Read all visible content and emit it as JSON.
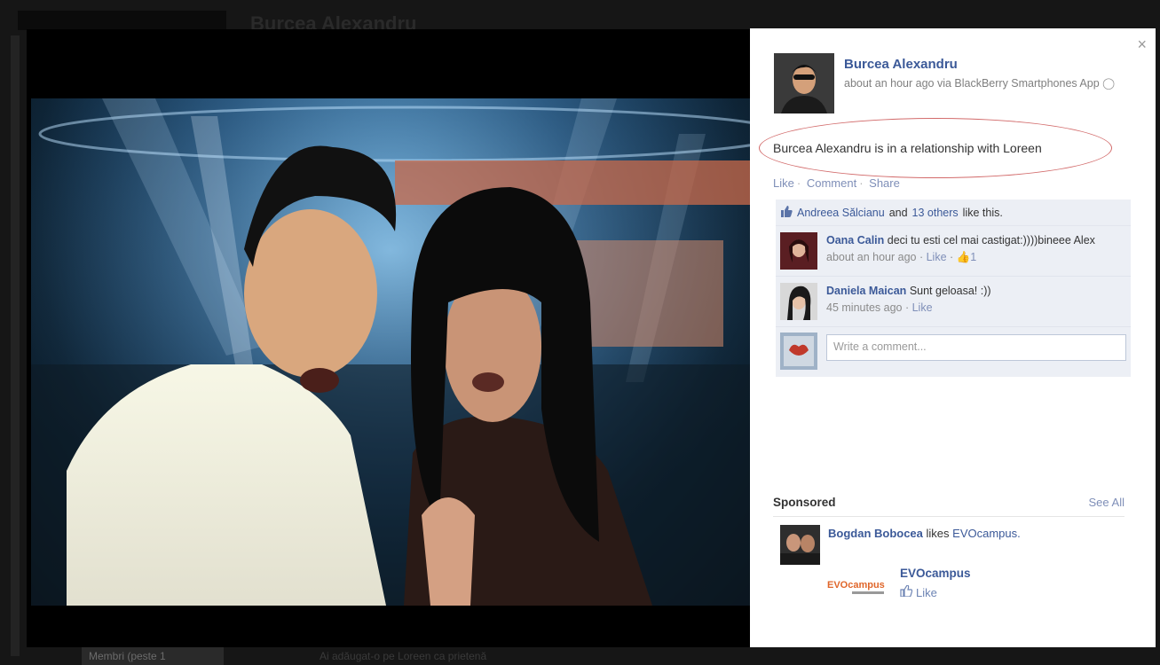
{
  "background": {
    "title": "Burcea Alexandru",
    "bottom_label": "Membri (peste 1",
    "bottom_text": "Ai adăugat-o pe Loreen ca prietenă"
  },
  "post": {
    "author_name": "Burcea Alexandru",
    "meta": "about an hour ago via BlackBerry Smartphones App",
    "status": "Burcea Alexandru is in a relationship with Loreen",
    "actions": {
      "like": "Like",
      "comment": "Comment",
      "share": "Share"
    },
    "close_label": "×"
  },
  "ufi": {
    "likes": {
      "name": "Andreea Sălcianu",
      "and": "and",
      "others": "13 others",
      "suffix": "like this."
    },
    "comments": [
      {
        "author": "Oana Calin",
        "text": "deci tu esti cel mai castigat:))))bineee Alex",
        "time": "about an hour ago",
        "like_label": "Like",
        "like_count": "1"
      },
      {
        "author": "Daniela Maican",
        "text": "Sunt geloasa! :))",
        "time": "45 minutes ago",
        "like_label": "Like"
      }
    ],
    "write_placeholder": "Write a comment..."
  },
  "sponsored": {
    "title": "Sponsored",
    "see_all": "See All",
    "liker": "Bogdan Bobocea",
    "likes_text": "likes",
    "page_link": "EVOcampus.",
    "page_name": "EVOcampus",
    "like_label": "Like",
    "logo_text": "EVOcampus"
  },
  "colors": {
    "link": "#3b5998",
    "oval": "#d26a6a"
  }
}
